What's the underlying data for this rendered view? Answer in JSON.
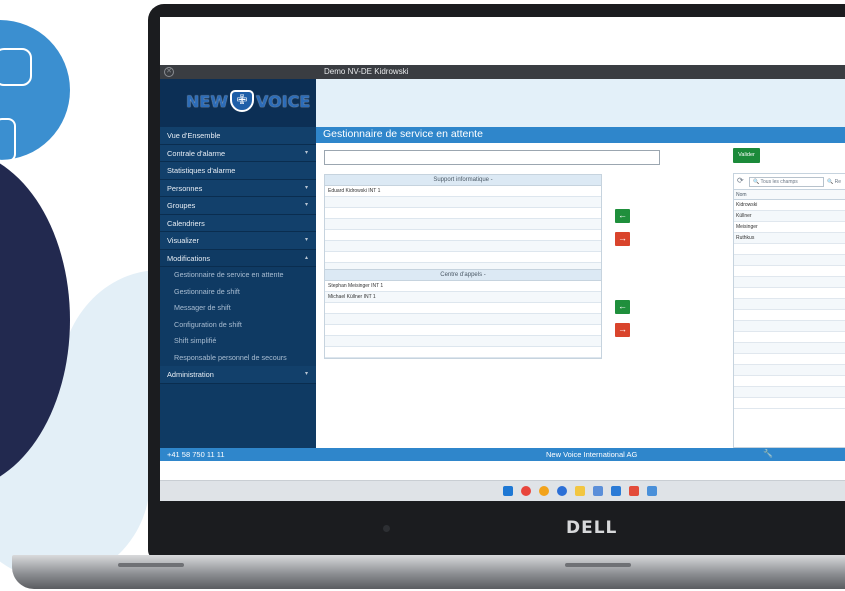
{
  "window": {
    "title": "Demo NV-DE Kidrowski"
  },
  "logo": {
    "word1": "NEW",
    "badge_glyph": "✙",
    "word2": "VOICE"
  },
  "sidebar": {
    "items": [
      {
        "label": "Vue d'Ensemble",
        "chevron": ""
      },
      {
        "label": "Contrale d'alarme",
        "chevron": "▾"
      },
      {
        "label": "Statistiques d'alarme",
        "chevron": ""
      },
      {
        "label": "Personnes",
        "chevron": "▾"
      },
      {
        "label": "Groupes",
        "chevron": "▾"
      },
      {
        "label": "Calendriers",
        "chevron": ""
      },
      {
        "label": "Visualizer",
        "chevron": "▾"
      },
      {
        "label": "Modifications",
        "chevron": "▴"
      }
    ],
    "subitems": [
      {
        "label": "Gestionnaire de service en attente"
      },
      {
        "label": "Gestionnaire de shift"
      },
      {
        "label": "Messager de shift"
      },
      {
        "label": "Configuration de shift"
      },
      {
        "label": "Shift simplifié"
      },
      {
        "label": "Responsable personnel de secours"
      }
    ],
    "admin": {
      "label": "Administration",
      "chevron": "▾"
    }
  },
  "page": {
    "title": "Gestionnaire de service en attente"
  },
  "search": {
    "value": ""
  },
  "validate_label": "Valider",
  "groups": [
    {
      "title": "Support informatique -",
      "rows": [
        "Eduard Kidrowski INT 1",
        "",
        "",
        "",
        "",
        "",
        "",
        ""
      ]
    },
    {
      "title": "Centre d'appels -",
      "rows": [
        "Stephan Meisinger INT 1",
        "Michael Küllner INT 1",
        "",
        "",
        "",
        "",
        ""
      ]
    }
  ],
  "arrows": {
    "add": "←",
    "remove": "→"
  },
  "right_grid": {
    "refresh_icon": "⟳",
    "search_placeholder": "🔍 Tous les champs",
    "search_button": "🔍 Re",
    "column": "Nom",
    "rows": [
      "Kidrowski",
      "Küllner",
      "Meisinger",
      "Ruthkus",
      "",
      "",
      "",
      "",
      "",
      "",
      "",
      "",
      "",
      "",
      "",
      "",
      "",
      "",
      ""
    ]
  },
  "footer": {
    "phone": "+41 58 750 11 11",
    "company": "New Voice International AG",
    "tool_icon": "🔧"
  },
  "device": {
    "brand": "DELL"
  },
  "colors": {
    "accent": "#2f86cb",
    "sidebar": "#0f3a63",
    "green": "#1f8f3c",
    "red": "#d9442c"
  }
}
